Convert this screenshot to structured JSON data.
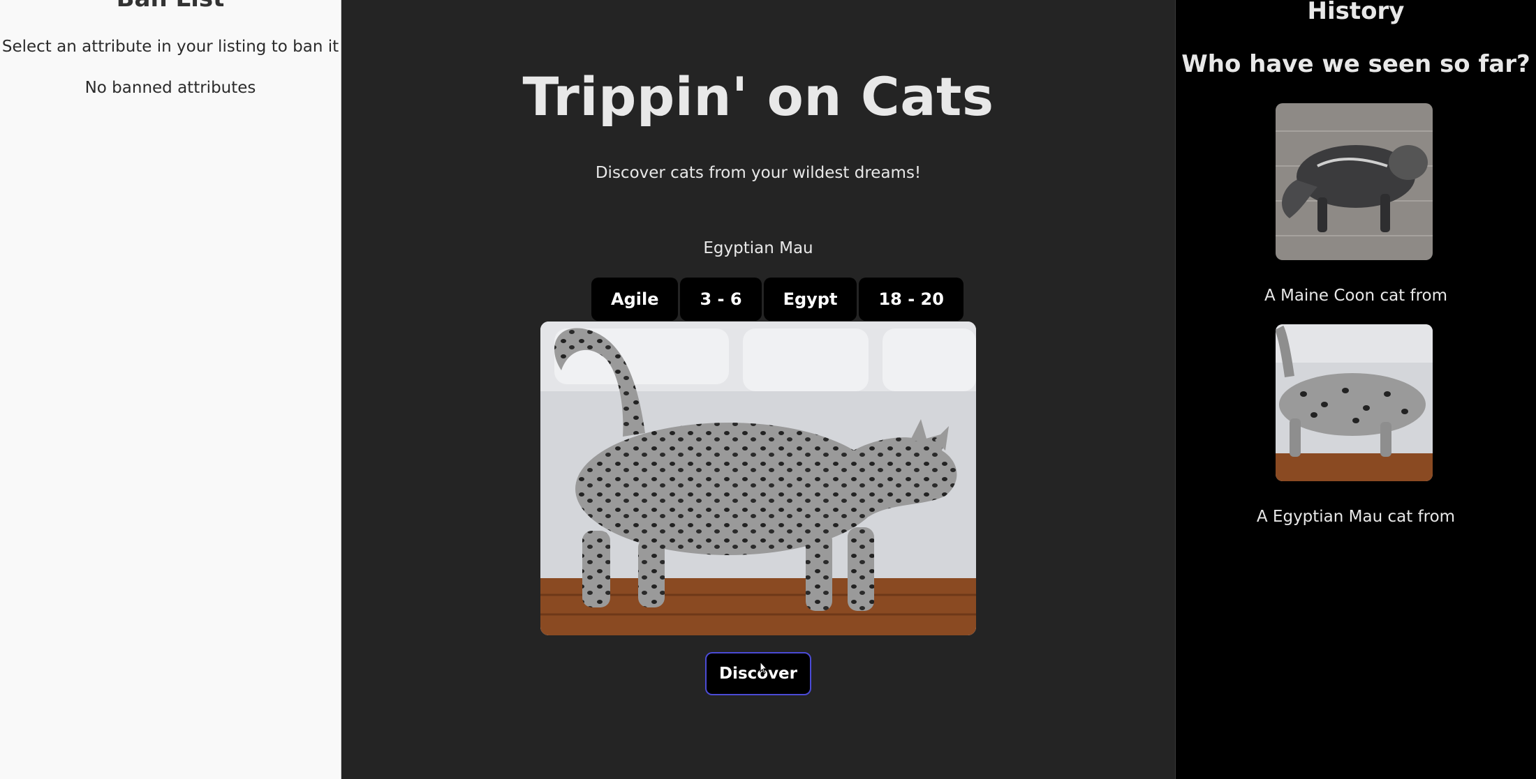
{
  "ban_list": {
    "title": "Ban List",
    "instruction": "Select an attribute in your listing to ban it",
    "empty_text": "No banned attributes"
  },
  "main": {
    "title": "Trippin' on Cats",
    "tagline": "Discover cats from your wildest dreams!",
    "breed_name": "Egyptian Mau",
    "attributes": [
      "Agile",
      "3 - 6",
      "Egypt",
      "18 - 20"
    ],
    "discover_label": "Discover"
  },
  "history": {
    "title": "History",
    "subtitle": "Who have we seen so far?",
    "items": [
      {
        "caption": "A Maine Coon cat from"
      },
      {
        "caption": "A Egyptian Mau cat from"
      }
    ]
  }
}
